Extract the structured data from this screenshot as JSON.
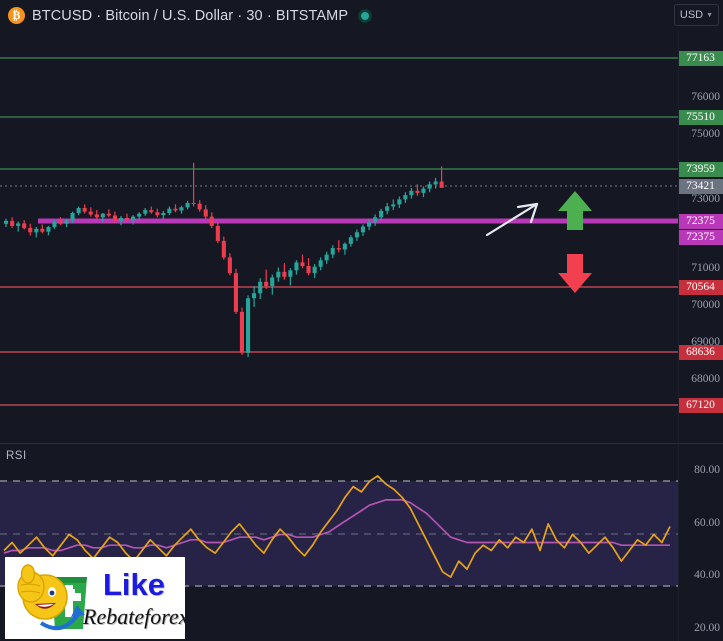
{
  "header": {
    "coin_icon": "bitcoin-icon",
    "symbol_line": "BTCUSD · Bitcoin / U.S. Dollar · 30 · BITSTAMP",
    "ticker": "BTCUSD",
    "name": "Bitcoin / U.S. Dollar",
    "interval": "30",
    "exchange": "BITSTAMP",
    "market_status": "online",
    "currency": "USD",
    "currency_chevron": "▼"
  },
  "price_axis": {
    "gridline_labels": [
      "76000",
      "75000",
      "73000",
      "71000",
      "70000",
      "69000",
      "68000"
    ],
    "tags": [
      {
        "value": "77163",
        "color": "#3a8c4e",
        "kind": "resistance"
      },
      {
        "value": "75510",
        "color": "#3a8c4e",
        "kind": "resistance"
      },
      {
        "value": "73959",
        "color": "#3a8c4e",
        "kind": "resistance"
      },
      {
        "value": "73421",
        "color": "#6b7280",
        "kind": "last-price"
      },
      {
        "value": "72375",
        "color": "#b838b8",
        "kind": "support"
      },
      {
        "value": "72375",
        "color": "#b838b8",
        "kind": "support"
      },
      {
        "value": "70564",
        "color": "#c62f3c",
        "kind": "support"
      },
      {
        "value": "68636",
        "color": "#c62f3c",
        "kind": "support"
      },
      {
        "value": "67120",
        "color": "#c62f3c",
        "kind": "support"
      }
    ]
  },
  "rsi": {
    "title": "RSI",
    "axis_labels": [
      "80.00",
      "60.00",
      "40.00",
      "20.00"
    ],
    "line_color": "#e8a317",
    "ma_color": "#b455b4",
    "band_color": "#262347"
  },
  "annotations": {
    "trend_arrow": "white-up-right-arrow",
    "bull_arrow": "green-up-arrow",
    "bear_arrow": "red-down-arrow"
  },
  "watermark": {
    "line1": "Like",
    "line2": "Rebateforex",
    "logo": "thumbs-up-smiley-money-icon"
  },
  "colors": {
    "background": "#151823",
    "up_candle": "#26a69a",
    "down_candle": "#ef3b4e",
    "support_magenta": "#b838b8",
    "resistance_green": "#3a8c4e",
    "support_red": "#c62f3c",
    "last_price_gray": "#6b7280"
  },
  "chart_data": {
    "type": "candlestick",
    "title": "BTCUSD · Bitcoin / U.S. Dollar · 30 · BITSTAMP",
    "xlabel": "",
    "ylabel": "USD",
    "ylim": [
      66300,
      77800
    ],
    "last_price": 73421,
    "horizontal_lines": [
      {
        "price": 77163,
        "color": "#3a8c4e",
        "style": "solid"
      },
      {
        "price": 75510,
        "color": "#3a8c4e",
        "style": "solid"
      },
      {
        "price": 73959,
        "color": "#3a8c4e",
        "style": "solid"
      },
      {
        "price": 73421,
        "color": "#787b86",
        "style": "dotted"
      },
      {
        "price": 72375,
        "color": "#b838b8",
        "style": "thick-solid"
      },
      {
        "price": 70564,
        "color": "#e04b5a",
        "style": "solid"
      },
      {
        "price": 68636,
        "color": "#e04b5a",
        "style": "solid"
      },
      {
        "price": 67120,
        "color": "#e04b5a",
        "style": "solid"
      }
    ],
    "ohlc": [
      [
        72420,
        72560,
        72330,
        72500
      ],
      [
        72500,
        72600,
        72300,
        72360
      ],
      [
        72360,
        72480,
        72200,
        72430
      ],
      [
        72430,
        72520,
        72260,
        72300
      ],
      [
        72300,
        72420,
        72090,
        72180
      ],
      [
        72180,
        72330,
        72040,
        72280
      ],
      [
        72280,
        72400,
        72150,
        72200
      ],
      [
        72200,
        72360,
        72100,
        72330
      ],
      [
        72330,
        72520,
        72270,
        72470
      ],
      [
        72470,
        72600,
        72380,
        72420
      ],
      [
        72420,
        72560,
        72330,
        72510
      ],
      [
        72510,
        72760,
        72450,
        72720
      ],
      [
        72720,
        72900,
        72660,
        72860
      ],
      [
        72860,
        72960,
        72700,
        72760
      ],
      [
        72760,
        72880,
        72620,
        72680
      ],
      [
        72680,
        72800,
        72540,
        72600
      ],
      [
        72600,
        72720,
        72460,
        72700
      ],
      [
        72700,
        72820,
        72600,
        72650
      ],
      [
        72650,
        72760,
        72450,
        72500
      ],
      [
        72500,
        72640,
        72380,
        72580
      ],
      [
        72580,
        72700,
        72470,
        72520
      ],
      [
        72520,
        72660,
        72400,
        72620
      ],
      [
        72620,
        72740,
        72520,
        72700
      ],
      [
        72700,
        72860,
        72640,
        72800
      ],
      [
        72800,
        72900,
        72700,
        72740
      ],
      [
        72740,
        72840,
        72600,
        72660
      ],
      [
        72660,
        72780,
        72540,
        72720
      ],
      [
        72720,
        72900,
        72660,
        72840
      ],
      [
        72840,
        72960,
        72740,
        72790
      ],
      [
        72790,
        72920,
        72700,
        72880
      ],
      [
        72880,
        73060,
        72820,
        73000
      ],
      [
        73000,
        74120,
        72900,
        72980
      ],
      [
        72980,
        73080,
        72760,
        72820
      ],
      [
        72820,
        72940,
        72560,
        72620
      ],
      [
        72620,
        72740,
        72300,
        72360
      ],
      [
        72360,
        72480,
        71880,
        71940
      ],
      [
        71940,
        72060,
        71420,
        71480
      ],
      [
        71480,
        71600,
        70980,
        71040
      ],
      [
        71040,
        71160,
        69900,
        69960
      ],
      [
        69960,
        70080,
        68760,
        68820
      ],
      [
        68820,
        70420,
        68700,
        70340
      ],
      [
        70340,
        70680,
        70100,
        70480
      ],
      [
        70480,
        70900,
        70320,
        70800
      ],
      [
        70800,
        71140,
        70600,
        70680
      ],
      [
        70680,
        71000,
        70440,
        70920
      ],
      [
        70920,
        71200,
        70800,
        71080
      ],
      [
        71080,
        71320,
        70860,
        70940
      ],
      [
        70940,
        71180,
        70700,
        71120
      ],
      [
        71120,
        71400,
        71000,
        71340
      ],
      [
        71340,
        71560,
        71180,
        71240
      ],
      [
        71240,
        71460,
        70980,
        71040
      ],
      [
        71040,
        71300,
        70900,
        71220
      ],
      [
        71220,
        71480,
        71120,
        71400
      ],
      [
        71400,
        71640,
        71300,
        71560
      ],
      [
        71560,
        71820,
        71460,
        71740
      ],
      [
        71740,
        71960,
        71620,
        71700
      ],
      [
        71700,
        71900,
        71560,
        71860
      ],
      [
        71860,
        72100,
        71780,
        72040
      ],
      [
        72040,
        72260,
        71940,
        72180
      ],
      [
        72180,
        72400,
        72080,
        72340
      ],
      [
        72340,
        72560,
        72240,
        72460
      ],
      [
        72460,
        72680,
        72360,
        72600
      ],
      [
        72600,
        72840,
        72520,
        72780
      ],
      [
        72780,
        73000,
        72680,
        72900
      ],
      [
        72900,
        73100,
        72800,
        72960
      ],
      [
        72960,
        73180,
        72860,
        73100
      ],
      [
        73100,
        73300,
        73000,
        73220
      ],
      [
        73220,
        73420,
        73120,
        73340
      ],
      [
        73340,
        73520,
        73200,
        73280
      ],
      [
        73280,
        73460,
        73160,
        73400
      ],
      [
        73400,
        73600,
        73300,
        73520
      ],
      [
        73520,
        73700,
        73400,
        73600
      ],
      [
        73600,
        74020,
        73500,
        73421
      ]
    ],
    "rsi_series": {
      "name": "RSI",
      "values": [
        48,
        51,
        47,
        50,
        53,
        49,
        46,
        50,
        54,
        52,
        48,
        45,
        49,
        53,
        51,
        47,
        44,
        48,
        52,
        49,
        46,
        50,
        53,
        56,
        52,
        49,
        47,
        51,
        55,
        58,
        54,
        50,
        47,
        52,
        56,
        53,
        49,
        46,
        50,
        55,
        59,
        63,
        68,
        72,
        70,
        74,
        76,
        73,
        71,
        68,
        64,
        58,
        52,
        46,
        40,
        38,
        44,
        41,
        47,
        50,
        48,
        52,
        49,
        53,
        51,
        56,
        48,
        58,
        52,
        49,
        54,
        51,
        47,
        50,
        53,
        49,
        44,
        48,
        52,
        50,
        54,
        51,
        57
      ],
      "ylim": [
        20,
        80
      ],
      "bands": {
        "upper": 70,
        "lower": 30,
        "mid": 50
      }
    },
    "rsi_ma": {
      "name": "RSI MA",
      "values": [
        47,
        48,
        48,
        49,
        49,
        49,
        48,
        48,
        49,
        50,
        50,
        49,
        49,
        50,
        50,
        50,
        49,
        49,
        50,
        50,
        49,
        50,
        51,
        52,
        52,
        51,
        51,
        51,
        52,
        53,
        53,
        53,
        52,
        53,
        54,
        54,
        53,
        53,
        53,
        54,
        55,
        57,
        59,
        61,
        63,
        65,
        66,
        67,
        67,
        67,
        66,
        64,
        62,
        59,
        56,
        53,
        52,
        51,
        51,
        51,
        51,
        51,
        51,
        51,
        51,
        51,
        51,
        51,
        51,
        51,
        51,
        51,
        51,
        51,
        51,
        51,
        50,
        50,
        50,
        50,
        50,
        50,
        50
      ]
    }
  }
}
